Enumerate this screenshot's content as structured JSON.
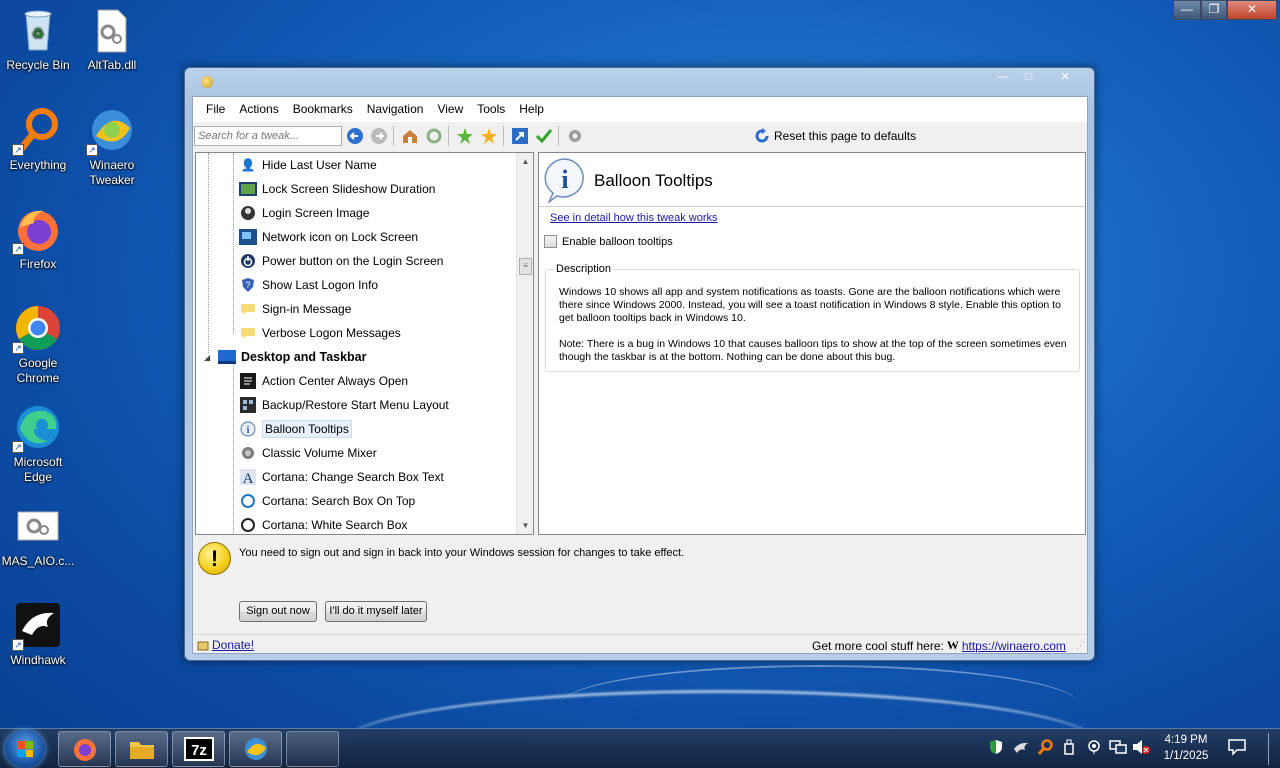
{
  "desktop": {
    "icons": [
      {
        "label": "Recycle Bin",
        "icon": "recycle-bin-icon"
      },
      {
        "label": "AltTab.dll",
        "icon": "dll-file-icon"
      },
      {
        "label": "Everything",
        "icon": "everything-search-icon"
      },
      {
        "label": "Winaero Tweaker",
        "icon": "winaero-tweaker-icon"
      },
      {
        "label": "Firefox",
        "icon": "firefox-icon"
      },
      {
        "label": "Google Chrome",
        "icon": "chrome-icon"
      },
      {
        "label": "Microsoft Edge",
        "icon": "edge-icon"
      },
      {
        "label": "MAS_AIO.c...",
        "icon": "script-file-icon"
      },
      {
        "label": "Windhawk",
        "icon": "windhawk-icon"
      }
    ]
  },
  "window": {
    "menu": [
      "File",
      "Actions",
      "Bookmarks",
      "Navigation",
      "View",
      "Tools",
      "Help"
    ],
    "search_placeholder": "Search for a tweak...",
    "reset_label": "Reset this page to defaults",
    "tree": {
      "items": [
        {
          "label": "Hide Last User Name",
          "icon": "user-icon"
        },
        {
          "label": "Lock Screen Slideshow Duration",
          "icon": "slideshow-icon"
        },
        {
          "label": "Login Screen Image",
          "icon": "user-circle-icon"
        },
        {
          "label": "Network icon on Lock Screen",
          "icon": "network-icon"
        },
        {
          "label": "Power button on the Login Screen",
          "icon": "power-icon"
        },
        {
          "label": "Show Last Logon Info",
          "icon": "help-shield-icon"
        },
        {
          "label": "Sign-in Message",
          "icon": "message-icon"
        },
        {
          "label": "Verbose Logon Messages",
          "icon": "message-icon"
        }
      ],
      "category": "Desktop and Taskbar",
      "sub_items": [
        {
          "label": "Action Center Always Open",
          "icon": "action-center-icon"
        },
        {
          "label": "Backup/Restore Start Menu Layout",
          "icon": "start-menu-icon"
        },
        {
          "label": "Balloon Tooltips",
          "icon": "info-icon",
          "selected": true
        },
        {
          "label": "Classic Volume Mixer",
          "icon": "volume-icon"
        },
        {
          "label": "Cortana: Change Search Box Text",
          "icon": "font-icon"
        },
        {
          "label": "Cortana: Search Box On Top",
          "icon": "cortana-icon"
        },
        {
          "label": "Cortana: White Search Box",
          "icon": "cortana-icon"
        }
      ]
    },
    "pane": {
      "title": "Balloon Tooltips",
      "detail_link": "See in detail how this tweak works",
      "checkbox_label": "Enable balloon tooltips",
      "checkbox_checked": false,
      "description_label": "Description",
      "description_p1": "Windows 10 shows all app and system notifications as toasts. Gone are the balloon notifications which were there since Windows 2000. Instead, you will see a toast notification in Windows 8 style. Enable this option to get balloon tooltips back in Windows 10.",
      "description_p2": "Note: There is a bug in Windows 10 that causes balloon tips to show at the top of the screen sometimes even though the taskbar is at the bottom. Nothing can be done about this bug."
    },
    "notice": "You need to sign out and sign in back into your Windows session for changes to take effect.",
    "sign_out_label": "Sign out now",
    "later_label": "I'll do it myself later",
    "donate_label": "Donate!",
    "more_label": "Get more cool stuff here:",
    "more_url": "https://winaero.com"
  },
  "taskbar": {
    "pinned": [
      "start-orb-icon",
      "firefox-icon",
      "file-explorer-icon",
      "7zip-icon",
      "winaero-tweaker-icon",
      "blank-window-icon"
    ],
    "time": "4:19 PM",
    "date": "1/1/2025"
  }
}
